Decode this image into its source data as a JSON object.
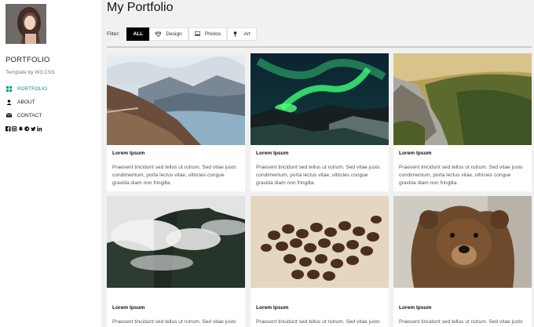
{
  "sidebar": {
    "brand": "PORTFOLIO",
    "tagline": "Template by W3.CSS",
    "nav": [
      {
        "label": "PORTFOLIO",
        "icon": "grid-icon",
        "active": true
      },
      {
        "label": "ABOUT",
        "icon": "user-icon",
        "active": false
      },
      {
        "label": "CONTACT",
        "icon": "envelope-icon",
        "active": false
      }
    ],
    "social_icons": [
      "facebook-icon",
      "instagram-icon",
      "snapchat-icon",
      "pinterest-icon",
      "twitter-icon",
      "linkedin-icon"
    ]
  },
  "main": {
    "title": "My Portfolio",
    "filter": {
      "label": "Filter:",
      "buttons": [
        {
          "label": "ALL",
          "icon": "",
          "active": true
        },
        {
          "label": "Design",
          "icon": "diamond-icon",
          "active": false
        },
        {
          "label": "Photos",
          "icon": "photo-icon",
          "active": false
        },
        {
          "label": "Art",
          "icon": "map-pin-icon",
          "active": false
        }
      ]
    },
    "cards": [
      {
        "image": "mountain-lake-photo",
        "title": "Lorem Ipsum",
        "text": "Praesent tincidunt sed tellus ut rutrum. Sed vitae justo condimentum, porta lectus vitae, ultricies congue gravida diam non fringilla."
      },
      {
        "image": "aurora-photo",
        "title": "Lorem Ipsum",
        "text": "Praesent tincidunt sed tellus ut rutrum. Sed vitae justo condimentum, porta lectus vitae, ultricies congue gravida diam non fringilla."
      },
      {
        "image": "canyon-valley-photo",
        "title": "Lorem Ipsum",
        "text": "Praesent tincidunt sed tellus ut rutrum. Sed vitae justo condimentum, porta lectus vitae, ultricies congue gravida diam non fringilla."
      },
      {
        "image": "misty-forest-photo",
        "title": "Lorem Ipsum",
        "text": "Praesent tincidunt sed tellus ut rutrum. Sed vitae justo"
      },
      {
        "image": "coffee-beans-photo",
        "title": "Lorem Ipsum",
        "text": "Praesent tincidunt sed tellus ut rutrum. Sed vitae justo"
      },
      {
        "image": "bear-photo",
        "title": "Lorem Ipsum",
        "text": "Praesent tincidunt sed tellus ut rutrum. Sed vitae justo"
      }
    ]
  },
  "colors": {
    "accent": "#009688",
    "background": "#f1f1f1",
    "filter_active": "#000000"
  }
}
